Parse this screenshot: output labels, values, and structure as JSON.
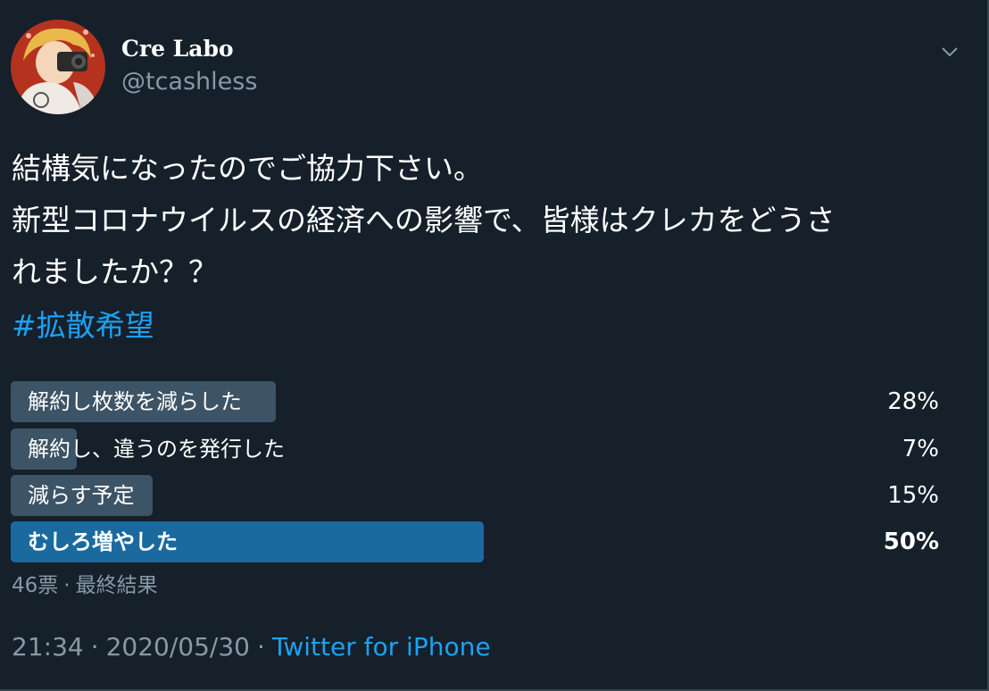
{
  "author": {
    "display_name": "Cre Labo",
    "handle": "@tcashless"
  },
  "tweet": {
    "lines": [
      "結構気になったのでご協力下さい。",
      "新型コロナウイルスの経済への影響で、皆様はクレカをどうさ",
      "れましたか？？"
    ],
    "hashtag": "#拡散希望"
  },
  "poll": {
    "options": [
      {
        "label": "解約し枚数を減らした",
        "percent": 28,
        "percent_text": "28%",
        "winner": false
      },
      {
        "label": "解約し、違うのを発行した",
        "percent": 7,
        "percent_text": "7%",
        "winner": false
      },
      {
        "label": "減らす予定",
        "percent": 15,
        "percent_text": "15%",
        "winner": false
      },
      {
        "label": "むしろ増やした",
        "percent": 50,
        "percent_text": "50%",
        "winner": true
      }
    ],
    "votes": "46票",
    "status": "最終結果"
  },
  "footer": {
    "time": "21:34",
    "date": "2020/05/30",
    "source": "Twitter for iPhone"
  },
  "colors": {
    "background": "#15202b",
    "bar": "#3d5466",
    "bar_winner": "#1a6aa0",
    "link": "#1da1f2",
    "secondary_text": "#8899a6"
  },
  "icons": {
    "menu": "chevron-down-icon",
    "avatar": "user-avatar"
  }
}
